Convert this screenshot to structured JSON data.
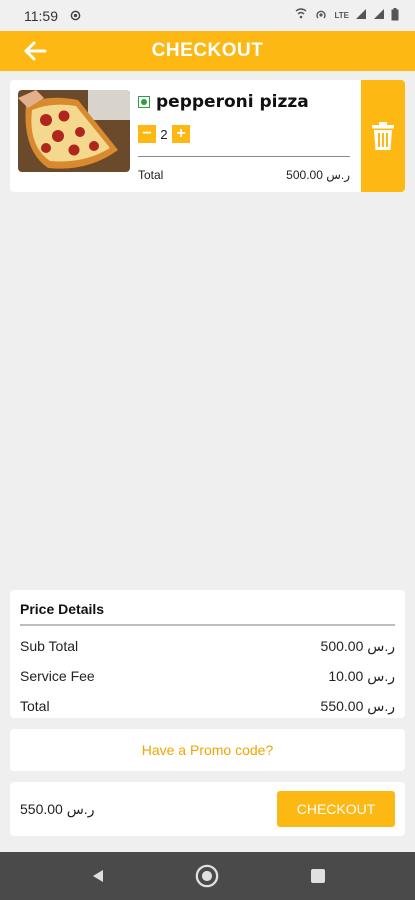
{
  "status_bar": {
    "time": "11:59",
    "right_icons": [
      "wifi-calling-icon",
      "hotspot-icon",
      "lte-signal-icon",
      "signal-icon",
      "signal-icon",
      "battery-icon"
    ],
    "lte_text": "LTE"
  },
  "header": {
    "title": "CHECKOUT",
    "back_icon": "arrow-left-icon",
    "background": "#fdb813"
  },
  "cart": {
    "items": [
      {
        "name": "pepperoni pizza",
        "veg_icon": "veg-indicator-icon",
        "quantity": "2",
        "decrease_label": "−",
        "increase_label": "+",
        "total_label": "Total",
        "total_value": "500.00 ر.س",
        "delete_icon": "trash-icon"
      }
    ]
  },
  "price_details": {
    "title": "Price Details",
    "rows": [
      {
        "label": "Sub Total",
        "value": "500.00 ر.س"
      },
      {
        "label": "Service Fee",
        "value": "10.00 ر.س"
      },
      {
        "label": "Total",
        "value": "550.00 ر.س"
      }
    ]
  },
  "promo": {
    "label": "Have a Promo code?",
    "color": "#f0a500"
  },
  "footer": {
    "total": "550.00 ر.س",
    "checkout_label": "CHECKOUT"
  },
  "nav_bar": {
    "back": "nav-back-icon",
    "home": "nav-home-icon",
    "recents": "nav-recents-icon"
  }
}
